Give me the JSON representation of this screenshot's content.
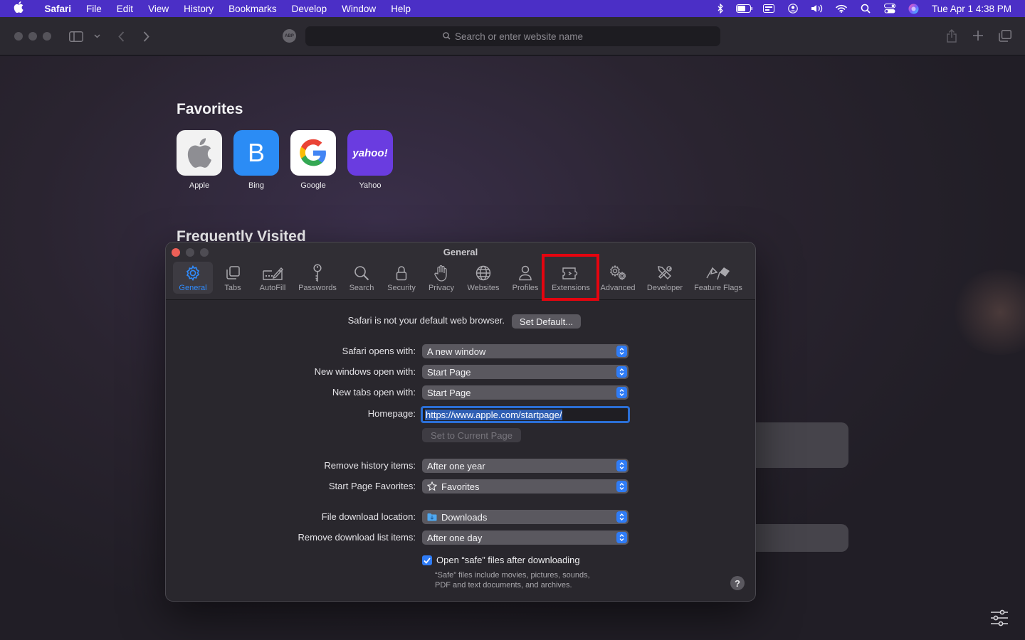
{
  "menubar": {
    "app_name": "Safari",
    "items": [
      "File",
      "Edit",
      "View",
      "History",
      "Bookmarks",
      "Develop",
      "Window",
      "Help"
    ],
    "clock": "Tue Apr 1  4:38 PM"
  },
  "toolbar": {
    "address_placeholder": "Search or enter website name",
    "abp_badge": "ABP"
  },
  "startpage": {
    "favorites_heading": "Favorites",
    "favorites": [
      {
        "label": "Apple",
        "tile_text": "",
        "color": "#f2f2f2"
      },
      {
        "label": "Bing",
        "tile_text": "B",
        "color": "#2b8cf5"
      },
      {
        "label": "Google",
        "tile_text": "G",
        "color": "#ffffff"
      },
      {
        "label": "Yahoo",
        "tile_text": "yahoo!",
        "color": "#6a3ce0"
      }
    ],
    "frequently_visited_heading": "Frequently Visited"
  },
  "prefs": {
    "title": "General",
    "tabs": [
      {
        "label": "General",
        "icon": "gear-icon",
        "active": true
      },
      {
        "label": "Tabs",
        "icon": "tabs-icon"
      },
      {
        "label": "AutoFill",
        "icon": "pencil-field-icon"
      },
      {
        "label": "Passwords",
        "icon": "key-icon"
      },
      {
        "label": "Search",
        "icon": "search-icon"
      },
      {
        "label": "Security",
        "icon": "lock-icon"
      },
      {
        "label": "Privacy",
        "icon": "hand-icon"
      },
      {
        "label": "Websites",
        "icon": "globe-icon"
      },
      {
        "label": "Profiles",
        "icon": "person-icon"
      },
      {
        "label": "Extensions",
        "icon": "puzzle-icon"
      },
      {
        "label": "Advanced",
        "icon": "gears-icon"
      },
      {
        "label": "Developer",
        "icon": "tools-icon"
      },
      {
        "label": "Feature Flags",
        "icon": "flags-icon"
      }
    ],
    "default_browser_text": "Safari is not your default web browser.",
    "set_default_button": "Set Default...",
    "rows": {
      "opens_with": {
        "label": "Safari opens with:",
        "value": "A new window"
      },
      "new_windows": {
        "label": "New windows open with:",
        "value": "Start Page"
      },
      "new_tabs": {
        "label": "New tabs open with:",
        "value": "Start Page"
      },
      "homepage": {
        "label": "Homepage:",
        "value": "https://www.apple.com/startpage/"
      },
      "set_current_page_button": "Set to Current Page",
      "remove_history": {
        "label": "Remove history items:",
        "value": "After one year"
      },
      "start_page_favorites": {
        "label": "Start Page Favorites:",
        "value": "Favorites"
      },
      "download_location": {
        "label": "File download location:",
        "value": "Downloads"
      },
      "remove_download_list": {
        "label": "Remove download list items:",
        "value": "After one day"
      }
    },
    "open_safe_files": {
      "label": "Open “safe” files after downloading",
      "checked": true,
      "note_line1": "“Safe” files include movies, pictures, sounds,",
      "note_line2": "PDF and text documents, and archives."
    },
    "help_button": "?"
  },
  "colors": {
    "menubar": "#4b2fc6",
    "accent": "#2f7cf6",
    "highlight_box": "#e5040f",
    "close": "#ed5f57"
  }
}
